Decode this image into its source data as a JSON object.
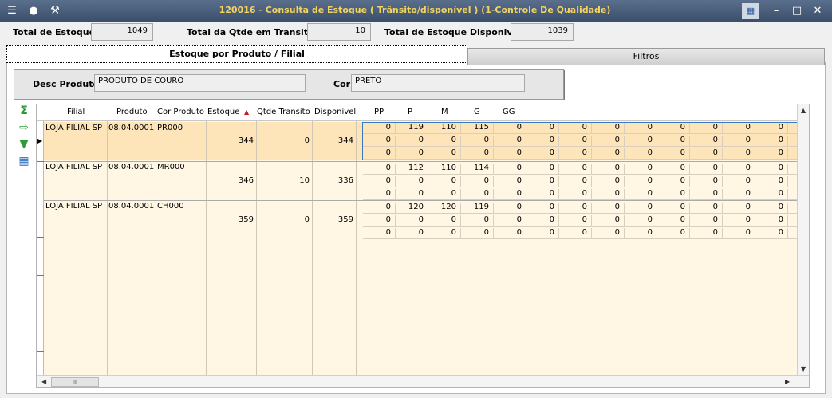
{
  "window": {
    "title": "120016 - Consulta de Estoque  ( Trânsito/disponível ) (1-Controle De Qualidade)"
  },
  "totals": {
    "estoque_label": "Total de Estoque",
    "estoque_value": "1049",
    "transito_label": "Total da Qtde em Transito",
    "transito_value": "10",
    "disponivel_label": "Total de Estoque Disponivel",
    "disponivel_value": "1039"
  },
  "tabs": [
    {
      "label": "Estoque por Produto / Filial",
      "active": true
    },
    {
      "label": "Filtros",
      "active": false
    }
  ],
  "filters": {
    "desc_produto_label": "Desc Produto",
    "desc_produto_value": "PRODUTO DE COURO",
    "cor_label": "Cor",
    "cor_value": "PRETO"
  },
  "grid": {
    "columns": [
      "Filial",
      "Produto",
      "Cor Produto",
      "Estoque",
      "Qtde Transito",
      "Disponivel"
    ],
    "size_columns": [
      "PP",
      "P",
      "M",
      "G",
      "GG"
    ],
    "sort_indicator": "▲",
    "rows": [
      {
        "filial": "LOJA FILIAL SP",
        "produto": "08.04.0001",
        "cor": "PR000",
        "estoque": "344",
        "transito": "0",
        "disponivel": "344",
        "sizes": [
          [
            "0",
            "119",
            "110",
            "115",
            "0",
            "0",
            "0",
            "0",
            "0",
            "0",
            "0",
            "0",
            "0"
          ],
          [
            "0",
            "0",
            "0",
            "0",
            "0",
            "0",
            "0",
            "0",
            "0",
            "0",
            "0",
            "0",
            "0"
          ],
          [
            "0",
            "0",
            "0",
            "0",
            "0",
            "0",
            "0",
            "0",
            "0",
            "0",
            "0",
            "0",
            "0"
          ]
        ]
      },
      {
        "filial": "LOJA FILIAL SP",
        "produto": "08.04.0001",
        "cor": "MR000",
        "estoque": "346",
        "transito": "10",
        "disponivel": "336",
        "sizes": [
          [
            "0",
            "112",
            "110",
            "114",
            "0",
            "0",
            "0",
            "0",
            "0",
            "0",
            "0",
            "0",
            "0"
          ],
          [
            "0",
            "0",
            "0",
            "0",
            "0",
            "0",
            "0",
            "0",
            "0",
            "0",
            "0",
            "0",
            "0"
          ],
          [
            "0",
            "0",
            "0",
            "0",
            "0",
            "0",
            "0",
            "0",
            "0",
            "0",
            "0",
            "0",
            "0"
          ]
        ]
      },
      {
        "filial": "LOJA FILIAL SP",
        "produto": "08.04.0001",
        "cor": "CH000",
        "estoque": "359",
        "transito": "0",
        "disponivel": "359",
        "sizes": [
          [
            "0",
            "120",
            "120",
            "119",
            "0",
            "0",
            "0",
            "0",
            "0",
            "0",
            "0",
            "0",
            "0"
          ],
          [
            "0",
            "0",
            "0",
            "0",
            "0",
            "0",
            "0",
            "0",
            "0",
            "0",
            "0",
            "0",
            "0"
          ],
          [
            "0",
            "0",
            "0",
            "0",
            "0",
            "0",
            "0",
            "0",
            "0",
            "0",
            "0",
            "0",
            "0"
          ]
        ]
      }
    ]
  },
  "scrollbar": {
    "thumb_label": "III"
  },
  "colors": {
    "title_text": "#f4d35e",
    "titlebar": "#4a5f7c",
    "grid_bg": "#fff7e4",
    "selected_row": "#fde5b9",
    "selection_border": "#3b78c4"
  },
  "icons": [
    "menu-icon",
    "traffic-light-icon",
    "wrench-icon",
    "sum-icon",
    "export-icon",
    "download-icon",
    "image-icon"
  ]
}
